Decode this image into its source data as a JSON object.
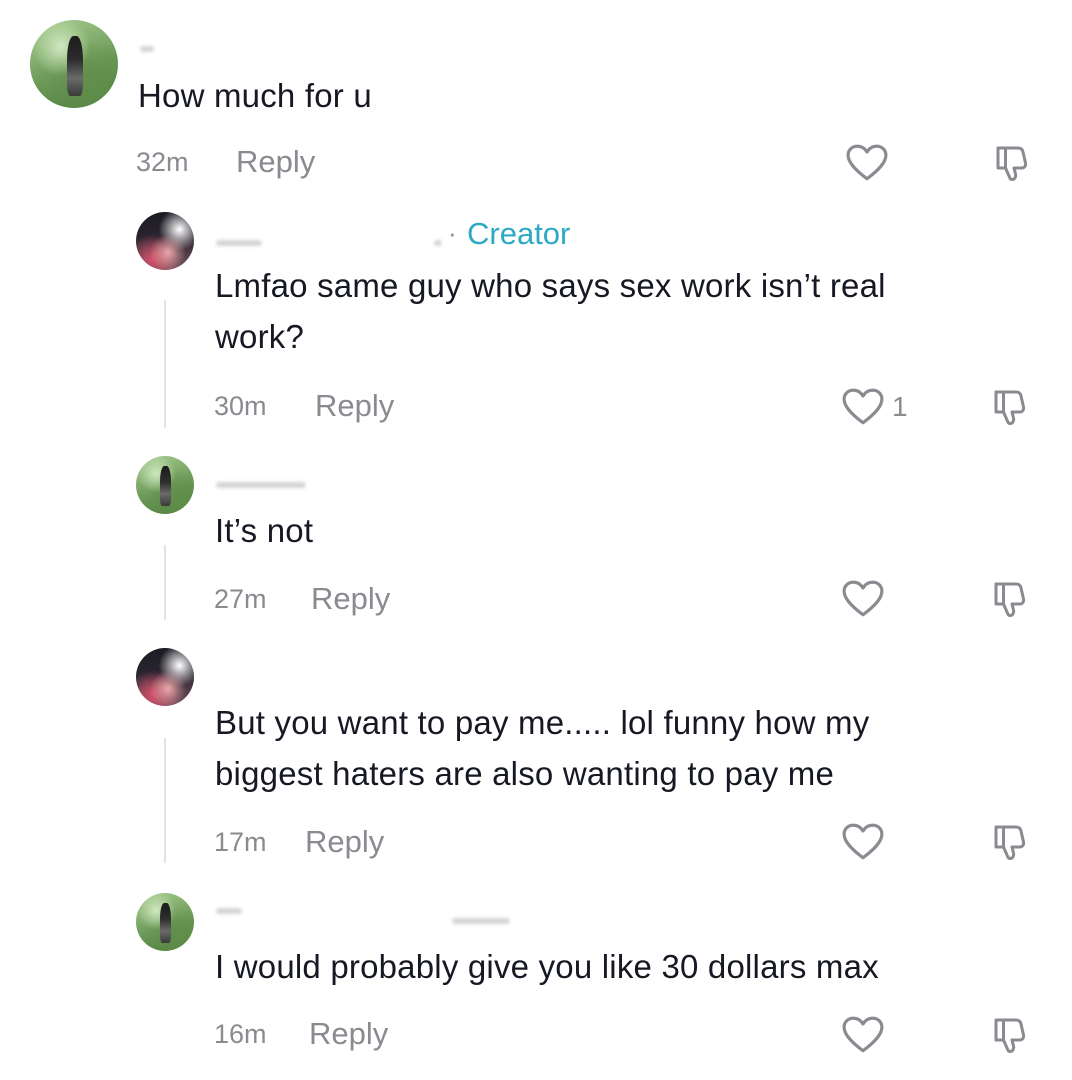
{
  "comments": [
    {
      "text": "How much for u",
      "time": "32m",
      "reply_label": "Reply",
      "like_icon": "heart-outline-icon",
      "dislike_icon": "thumbs-down-icon"
    },
    {
      "creator_label": "Creator",
      "text_line1": "Lmfao same guy who says sex work isn’t real",
      "text_line2": "work?",
      "time": "30m",
      "reply_label": "Reply",
      "like_count": "1",
      "like_icon": "heart-outline-icon",
      "dislike_icon": "thumbs-down-icon"
    },
    {
      "text": "It’s not",
      "time": "27m",
      "reply_label": "Reply",
      "like_icon": "heart-outline-icon",
      "dislike_icon": "thumbs-down-icon"
    },
    {
      "text_line1": "But you want to pay me..... lol funny how my",
      "text_line2": "biggest haters are also wanting to pay me",
      "time": "17m",
      "reply_label": "Reply",
      "like_icon": "heart-outline-icon",
      "dislike_icon": "thumbs-down-icon"
    },
    {
      "text": "I would probably give you like 30 dollars max",
      "time": "16m",
      "reply_label": "Reply",
      "like_icon": "heart-outline-icon",
      "dislike_icon": "thumbs-down-icon"
    }
  ],
  "colors": {
    "text": "#161823",
    "muted": "#8a8b91",
    "creator": "#2caac4",
    "thread_line": "#e3e3e4"
  }
}
